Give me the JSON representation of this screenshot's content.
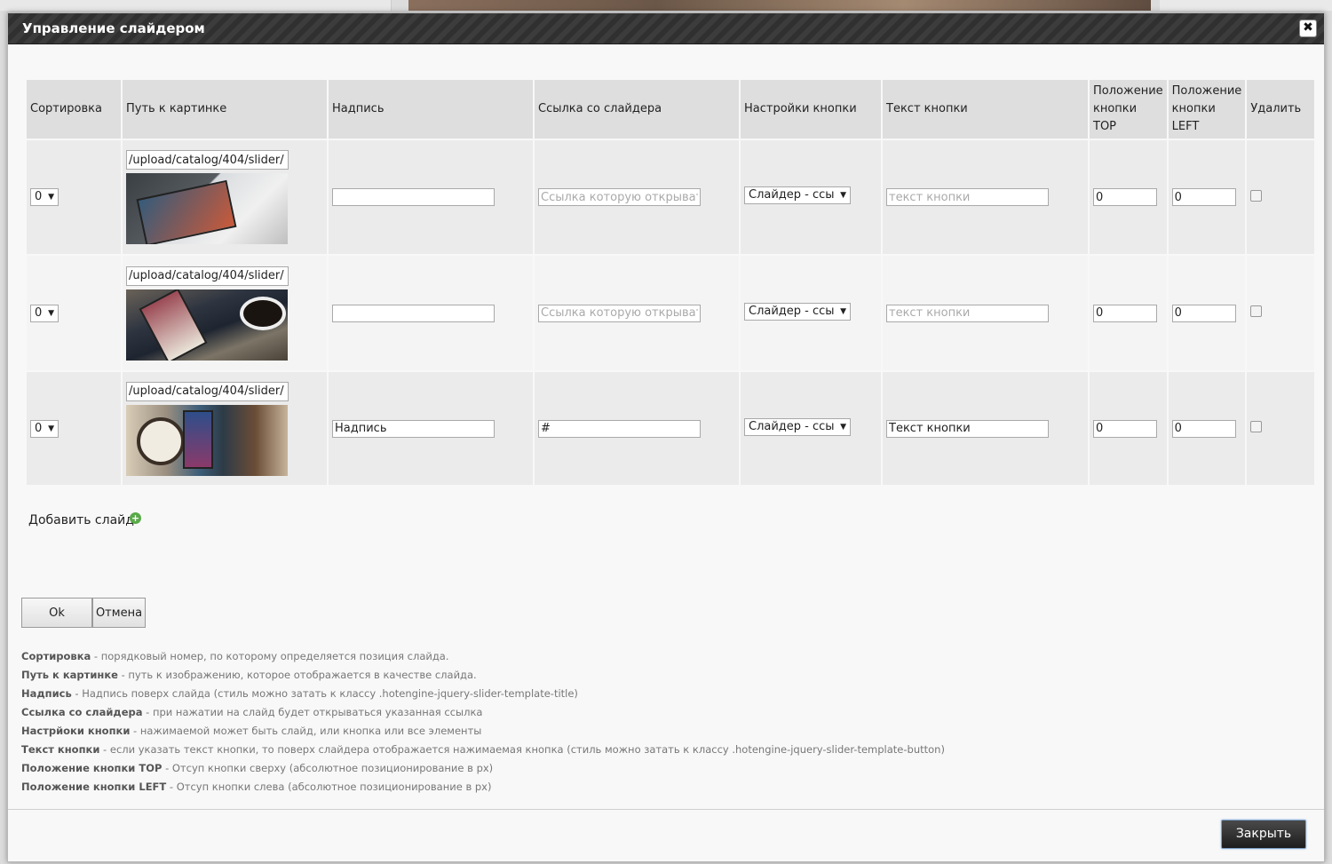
{
  "dialog": {
    "title": "Управление слайдером"
  },
  "table": {
    "headers": [
      "Сортировка",
      "Путь к картинке",
      "Надпись",
      "Ссылка со слайдера",
      "Настройки кнопки",
      "Текст кнопки",
      "Положение кнопки TOP",
      "Положение кнопки LEFT",
      "Удалить"
    ],
    "rows": [
      {
        "sort": "0",
        "path": "/upload/catalog/404/slider/",
        "caption": "",
        "link": "",
        "link_placeholder": "Ссылка которую открыват",
        "button_setting": "Слайдер - ссы",
        "button_text": "",
        "button_text_placeholder": "текст кнопки",
        "top": "0",
        "left": "0"
      },
      {
        "sort": "0",
        "path": "/upload/catalog/404/slider/",
        "caption": "",
        "link": "",
        "link_placeholder": "Ссылка которую открыват",
        "button_setting": "Слайдер - ссы",
        "button_text": "",
        "button_text_placeholder": "текст кнопки",
        "top": "0",
        "left": "0"
      },
      {
        "sort": "0",
        "path": "/upload/catalog/404/slider/",
        "caption": "Надпись",
        "link": "#",
        "link_placeholder": "Ссылка которую открыват",
        "button_setting": "Слайдер - ссы",
        "button_text": "Текст кнопки",
        "button_text_placeholder": "текст кнопки",
        "top": "0",
        "left": "0"
      }
    ]
  },
  "add_slide_label": "Добавить слайд",
  "buttons": {
    "ok": "Ok",
    "cancel": "Отмена",
    "close": "Закрыть"
  },
  "help": [
    {
      "term": "Сортировка",
      "desc": " - порядковый номер, по которому определяется позиция слайда."
    },
    {
      "term": "Путь к картинке",
      "desc": " - путь к изображению, которое отображается в качестве слайда."
    },
    {
      "term": "Надпись",
      "desc": " - Надпись поверх слайда (стиль можно затать к классу .hotengine-jquery-slider-template-title)"
    },
    {
      "term": "Ссылка со слайдера",
      "desc": " - при нажатии на слайд будет открываться указанная ссылка"
    },
    {
      "term": "Настрйоки кнопки",
      "desc": " - нажимаемой может быть слайд, или кнопка или все элементы"
    },
    {
      "term": "Текст кнопки",
      "desc": " - если указать текст кнопки, то поверх слайдера отображается нажимаемая кнопка (стиль можно затать к классу .hotengine-jquery-slider-template-button)"
    },
    {
      "term": "Положение кнопки TOP",
      "desc": " - Отсуп кнопки сверху (абсолютное позиционирование в px)"
    },
    {
      "term": "Положение кнопки LEFT",
      "desc": " - Отсуп кнопки слева (абсолютное позиционирование в px)"
    }
  ]
}
